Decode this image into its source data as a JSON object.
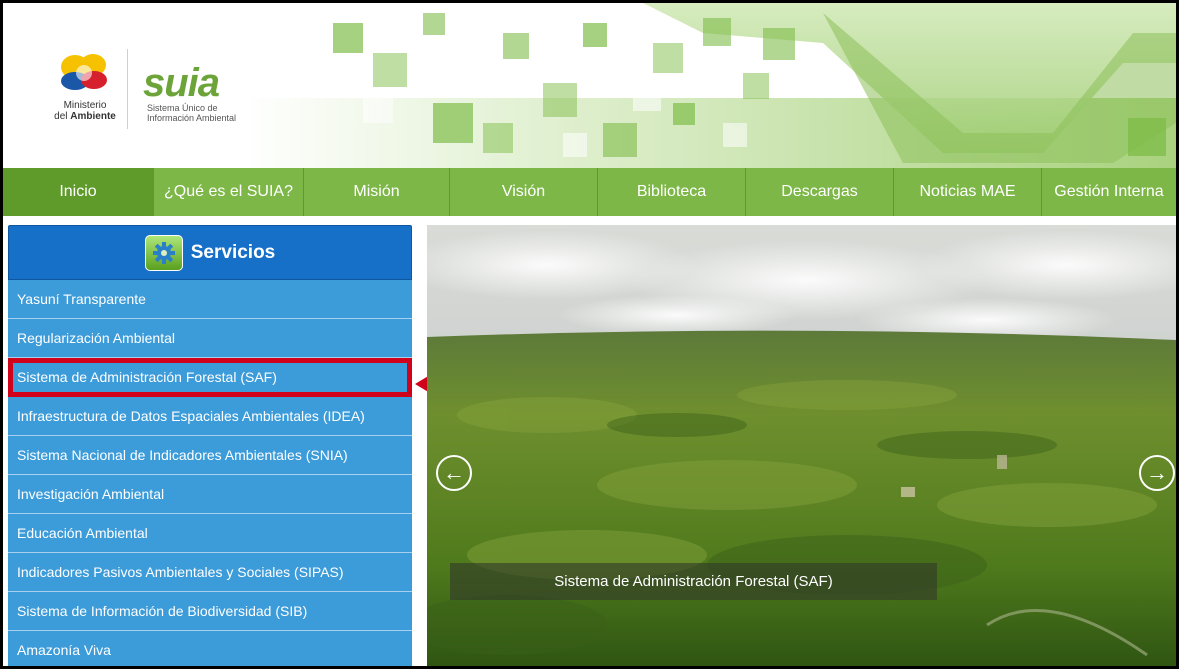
{
  "header": {
    "ministry_line1": "Ministerio",
    "ministry_line2_prefix": "del ",
    "ministry_line2_bold": "Ambiente",
    "suia_logo": "suia",
    "suia_sub_line1": "Sistema Único de",
    "suia_sub_line2": "Información Ambiental"
  },
  "nav": {
    "items": [
      {
        "label": "Inicio",
        "active": true
      },
      {
        "label": "¿Qué es el SUIA?"
      },
      {
        "label": "Misión"
      },
      {
        "label": "Visión"
      },
      {
        "label": "Biblioteca"
      },
      {
        "label": "Descargas"
      },
      {
        "label": "Noticias MAE"
      },
      {
        "label": "Gestión Interna"
      }
    ]
  },
  "services": {
    "title": "Servicios",
    "icon": "gear-icon",
    "items": [
      {
        "label": "Yasuní Transparente"
      },
      {
        "label": "Regularización Ambiental"
      },
      {
        "label": "Sistema de Administración Forestal (SAF)",
        "highlighted": true
      },
      {
        "label": "Infraestructura de Datos Espaciales Ambientales (IDEA)"
      },
      {
        "label": "Sistema Nacional de Indicadores Ambientales (SNIA)"
      },
      {
        "label": "Investigación Ambiental"
      },
      {
        "label": "Educación Ambiental"
      },
      {
        "label": "Indicadores Pasivos Ambientales y Sociales (SIPAS)"
      },
      {
        "label": "Sistema de Información de Biodiversidad (SIB)"
      },
      {
        "label": "Amazonía Viva"
      }
    ]
  },
  "slider": {
    "caption": "Sistema de Administración Forestal (SAF)",
    "prev_icon": "arrow-left-icon",
    "next_icon": "arrow-right-icon"
  },
  "colors": {
    "nav_green": "#7db748",
    "nav_active": "#5e9b2a",
    "service_blue": "#3c9bd9",
    "service_header": "#1670c8",
    "highlight_red": "#d0021b"
  }
}
